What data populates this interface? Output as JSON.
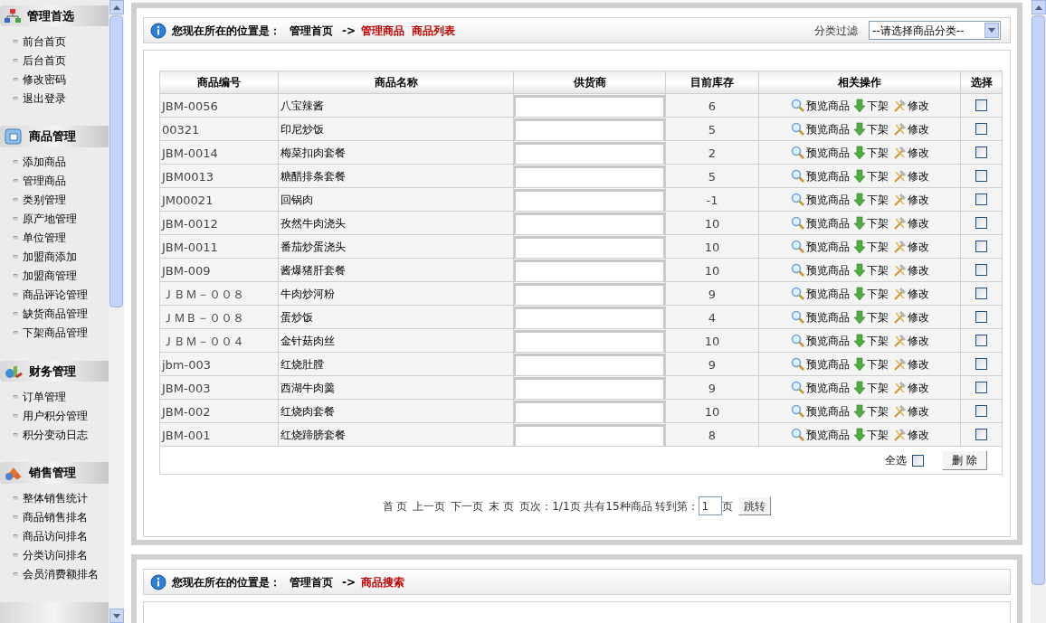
{
  "sidebar": {
    "sections": [
      {
        "title": "管理首选",
        "items": [
          "前台首页",
          "后台首页",
          "修改密码",
          "退出登录"
        ]
      },
      {
        "title": "商品管理",
        "items": [
          "添加商品",
          "管理商品",
          "类别管理",
          "原产地管理",
          "单位管理",
          "加盟商添加",
          "加盟商管理",
          "商品评论管理",
          "缺货商品管理",
          "下架商品管理"
        ]
      },
      {
        "title": "财务管理",
        "items": [
          "订单管理",
          "用户积分管理",
          "积分变动日志"
        ]
      },
      {
        "title": "销售管理",
        "items": [
          "整体销售统计",
          "商品销售排名",
          "商品访问排名",
          "分类访问排名",
          "会员消费额排名"
        ]
      }
    ]
  },
  "panel": {
    "location_label": "您现在所在的位置是：",
    "home": "管理首页",
    "arrow": "->",
    "path": "管理商品  商品列表",
    "filter_label": "分类过滤",
    "filter_select": "--请选择商品分类--",
    "table": {
      "columns": [
        "商品编号",
        "商品名称",
        "供货商",
        "目前库存",
        "相关操作",
        "选择"
      ],
      "rows": [
        {
          "code": "JBM-0056",
          "name": "八宝辣酱",
          "stock": "6",
          "actions": [
            "预览商品",
            "下架",
            "修改"
          ],
          "checked": false
        },
        {
          "code": "00321",
          "name": "印尼炒饭",
          "stock": "5",
          "actions": [
            "预览商品",
            "下架",
            "修改"
          ],
          "checked": false
        },
        {
          "code": "JBM-0014",
          "name": "梅菜扣肉套餐",
          "stock": "2",
          "actions": [
            "预览商品",
            "下架",
            "修改"
          ],
          "checked": false
        },
        {
          "code": "JBM0013",
          "name": "糖醋排条套餐",
          "stock": "5",
          "actions": [
            "预览商品",
            "下架",
            "修改"
          ],
          "checked": false
        },
        {
          "code": "JM00021",
          "name": "回锅肉",
          "stock": "-1",
          "actions": [
            "预览商品",
            "下架",
            "修改"
          ],
          "checked": false
        },
        {
          "code": "JBM-0012",
          "name": "孜然牛肉浇头",
          "stock": "10",
          "actions": [
            "预览商品",
            "下架",
            "修改"
          ],
          "checked": false
        },
        {
          "code": "JBM-0011",
          "name": "番茄炒蛋浇头",
          "stock": "10",
          "actions": [
            "预览商品",
            "下架",
            "修改"
          ],
          "checked": false
        },
        {
          "code": "JBM-009",
          "name": "酱爆猪肝套餐",
          "stock": "10",
          "actions": [
            "预览商品",
            "下架",
            "修改"
          ],
          "checked": false
        },
        {
          "code": "ＪＢＭ－００８",
          "name": "牛肉炒河粉",
          "stock": "9",
          "actions": [
            "预览商品",
            "下架",
            "修改"
          ],
          "checked": false
        },
        {
          "code": "ＪＭＢ－００８",
          "name": "蛋炒饭",
          "stock": "4",
          "actions": [
            "预览商品",
            "下架",
            "修改"
          ],
          "checked": false
        },
        {
          "code": "ＪＢＭ－００４",
          "name": "金针菇肉丝",
          "stock": "10",
          "actions": [
            "预览商品",
            "下架",
            "修改"
          ],
          "checked": false
        },
        {
          "code": "jbm-003",
          "name": "红烧肚膛",
          "stock": "9",
          "actions": [
            "预览商品",
            "下架",
            "修改"
          ],
          "checked": false
        },
        {
          "code": "JBM-003",
          "name": "西湖牛肉羹",
          "stock": "9",
          "actions": [
            "预览商品",
            "下架",
            "修改"
          ],
          "checked": false
        },
        {
          "code": "JBM-002",
          "name": "红烧肉套餐",
          "stock": "10",
          "actions": [
            "预览商品",
            "下架",
            "修改"
          ],
          "checked": false
        },
        {
          "code": "JBM-001",
          "name": "红烧蹄膀套餐",
          "stock": "8",
          "actions": [
            "预览商品",
            "下架",
            "修改"
          ],
          "checked": false
        }
      ],
      "select_all_label": "全选",
      "select_all_checked": false,
      "delete_button": "删 除"
    },
    "pager": {
      "links": [
        "首 页",
        "上一页",
        "下一页",
        "末 页"
      ],
      "info": "页次：1/1页 共有15种商品 转到第：",
      "page_value": "1",
      "page_suffix": "页",
      "go_button": "跳转"
    }
  },
  "panel2": {
    "location_label": "您现在所在的位置是：",
    "home": "管理首页",
    "arrow": "->",
    "path": "商品搜索"
  }
}
